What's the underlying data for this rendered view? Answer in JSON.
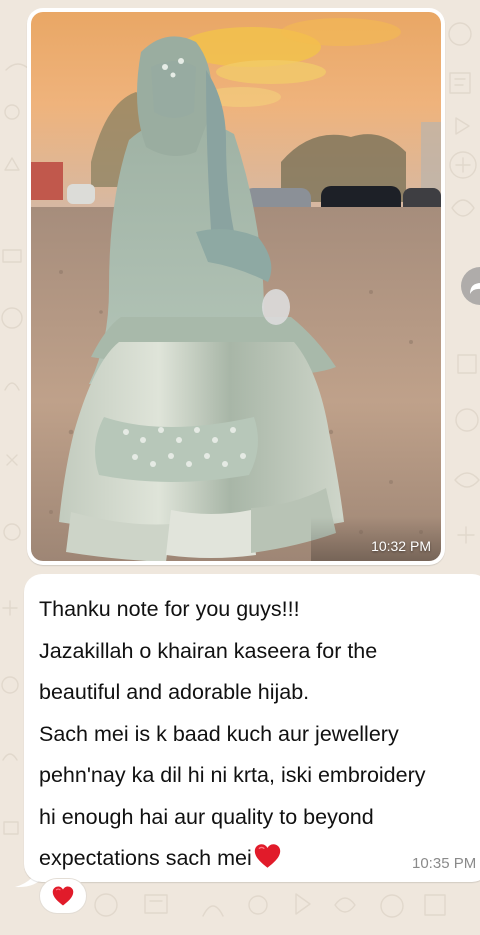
{
  "chat": {
    "wallpaper_color": "#efe7dd",
    "image_message": {
      "photo_icon": "photo-content",
      "time": "10:32 PM"
    },
    "forward_icon": "forward-share-icon",
    "text_message": {
      "lines": [
        "Thanku note for you guys!!!",
        "Jazakillah o khairan kaseera for the",
        "beautiful and adorable hijab.",
        "Sach mei is k baad kuch aur jewellery",
        "pehn'nay ka dil hi ni krta, iski embroidery",
        "hi enough hai aur quality to beyond",
        "expectations sach mei"
      ],
      "trailing_emoji": "red-heart-emoji",
      "time": "10:35 PM"
    },
    "reaction": {
      "emoji_icon": "red-heart-emoji"
    }
  },
  "colors": {
    "bubble": "#ffffff",
    "text": "#111111",
    "timestamp": "#8a8a8a",
    "heart": "#e11b2a"
  }
}
